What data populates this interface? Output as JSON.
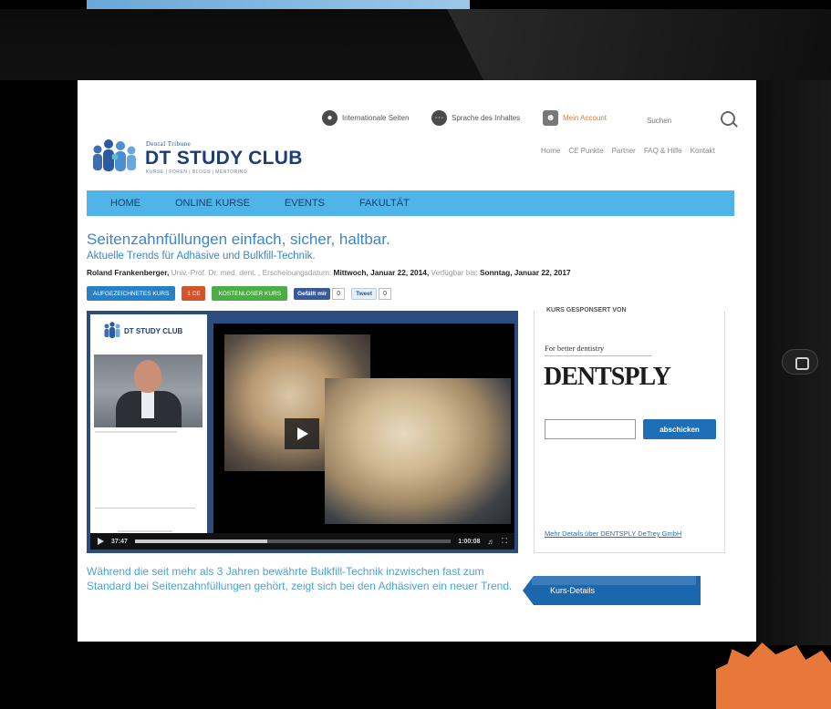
{
  "topbar": {
    "international": "Internationale Seiten",
    "language": "Sprache des Inhaltes",
    "account": "Mein Account",
    "search_placeholder": "Suchen"
  },
  "logo": {
    "brand": "Dental Tribune",
    "title": "DT STUDY CLUB",
    "tagline": "KURSE | FOREN | BLOGS | MENTORING"
  },
  "secondary_nav": [
    "Home",
    "CE Punkte",
    "Partner",
    "FAQ & Hilfe",
    "Kontakt"
  ],
  "main_nav": [
    "HOME",
    "ONLINE KURSE",
    "EVENTS",
    "FAKULTÄT"
  ],
  "course": {
    "title": "Seitenzahnfüllungen einfach, sicher, haltbar.",
    "subtitle": "Aktuelle Trends für Adhäsive und Bulkfill-Technik.",
    "author": "Roland Frankenberger,",
    "author_title": " Univ.-Prof. Dr. med. dent. , Erscheinungsdatum: ",
    "published": "Mittwoch, Januar 22, 2014,",
    "available_label": " Verfügbar bis: ",
    "available_until": "Sonntag, Januar 22, 2017"
  },
  "badges": {
    "recorded": "AUFGEZEICHNETES KURS",
    "ce": "1 CE",
    "free": "KOSTENLOSER KURS",
    "facebook": "Gefällt mir",
    "facebook_count": "0",
    "tweet": "Tweet",
    "tweet_count": "0"
  },
  "video": {
    "side_logo": "DT STUDY CLUB",
    "time_current": "37:47",
    "time_total": "1:00:08",
    "progress": 0.42
  },
  "sponsor": {
    "heading": "KURS GESPONSERT VON",
    "slogan": "For better dentistry",
    "brand": "DENTSPLY",
    "submit": "abschicken",
    "link": "Mehr Details über DENTSPLY DeTrey GmbH"
  },
  "description": "Während die seit mehr als 3 Jahren bewährte Bulkfill-Technik inzwischen fast zum Standard bei Seitenzahnfüllungen gehört, zeigt sich bei den Adhäsiven ein neuer Trend.",
  "kurs_details": "Kurs-Details"
}
